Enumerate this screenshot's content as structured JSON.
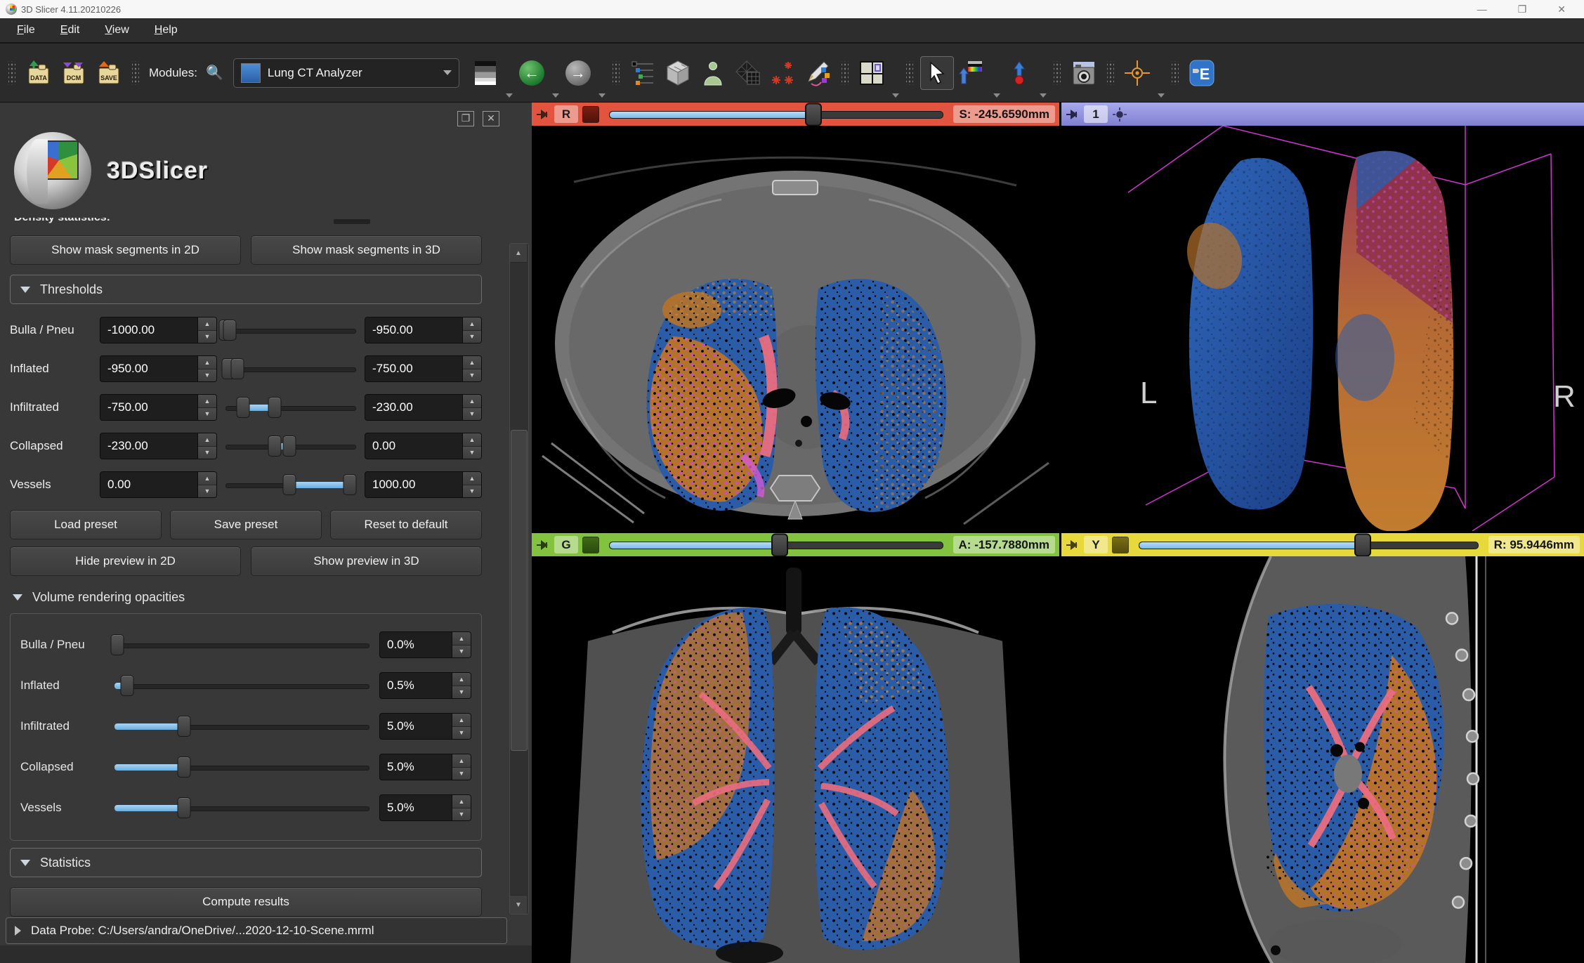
{
  "window": {
    "title": "3D Slicer 4.11.20210226"
  },
  "menu": {
    "items": [
      "File",
      "Edit",
      "View",
      "Help"
    ]
  },
  "toolbar": {
    "modules_label": "Modules:",
    "module_selected": "Lung CT Analyzer",
    "icon_names": [
      "load-data",
      "import-dicom",
      "save",
      "module-search",
      "module-history",
      "back",
      "forward",
      "subject-hierarchy",
      "volume-rendering",
      "segmentations",
      "mesh",
      "markups-seeds",
      "annotations",
      "layout-selector",
      "mouse-interaction",
      "adjust-window-level",
      "place-fiducial",
      "screenshot",
      "crosshair",
      "extensions-manager"
    ]
  },
  "panel": {
    "logo_text": "3DSlicer",
    "clipped_label": "Density statistics:",
    "buttons": {
      "show_mask_2d": "Show mask segments in 2D",
      "show_mask_3d": "Show mask segments in 3D",
      "load_preset": "Load preset",
      "save_preset": "Save preset",
      "reset_default": "Reset to default",
      "hide_preview_2d": "Hide preview in 2D",
      "show_preview_3d": "Show preview in 3D",
      "compute_results": "Compute results"
    },
    "sections": {
      "thresholds": "Thresholds",
      "opacities": "Volume rendering opacities",
      "statistics": "Statistics"
    },
    "thresholds": [
      {
        "label": "Bulla / Pneu",
        "min": "-1000.00",
        "max": "-950.00",
        "lo": 1,
        "hi": 4,
        "fill": 3
      },
      {
        "label": "Inflated",
        "min": "-950.00",
        "max": "-750.00",
        "lo": 3,
        "hi": 10,
        "fill": 7
      },
      {
        "label": "Infiltrated",
        "min": "-750.00",
        "max": "-230.00",
        "lo": 14,
        "hi": 38,
        "fill": 24
      },
      {
        "label": "Collapsed",
        "min": "-230.00",
        "max": "0.00",
        "lo": 38,
        "hi": 49,
        "fill": 11
      },
      {
        "label": "Vessels",
        "min": "0.00",
        "max": "1000.00",
        "lo": 49,
        "hi": 94,
        "fill": 45
      }
    ],
    "opacities": [
      {
        "label": "Bulla / Pneu",
        "value": "0.0%",
        "pct": 1
      },
      {
        "label": "Inflated",
        "value": "0.5%",
        "pct": 5
      },
      {
        "label": "Infiltrated",
        "value": "5.0%",
        "pct": 27
      },
      {
        "label": "Collapsed",
        "value": "5.0%",
        "pct": 27
      },
      {
        "label": "Vessels",
        "value": "5.0%",
        "pct": 27
      }
    ],
    "data_probe": "Data Probe: C:/Users/andra/OneDrive/...2020-12-10-Scene.mrml"
  },
  "viewports": {
    "red": {
      "label": "R",
      "value": "S: -245.6590mm",
      "color": "#e2543e",
      "slider_pct": 61
    },
    "threeD": {
      "label": "1",
      "marker_left": "L",
      "marker_right": "R",
      "color": "#9a9ade"
    },
    "green": {
      "label": "G",
      "value": "A: -157.7880mm",
      "color": "#82c23e",
      "slider_pct": 51
    },
    "yellow": {
      "label": "Y",
      "value": "R: 95.9446mm",
      "color": "#e7d83b",
      "slider_pct": 66
    }
  },
  "colors": {
    "lung_blue": "#2a5ca8",
    "infiltrate_orange": "#b5722a",
    "vessel_pink": "#ea6d7f",
    "collapsed_magenta": "#c84fc8",
    "wirebox_magenta": "#e63ce6",
    "slider_blue": "#7cb9e8"
  }
}
